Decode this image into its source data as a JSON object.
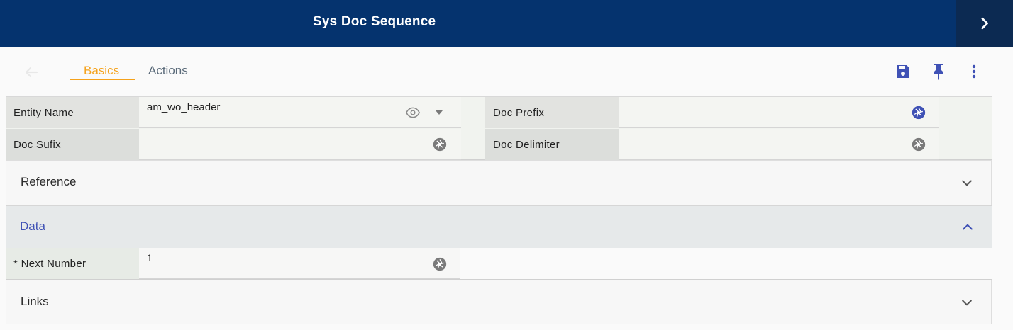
{
  "header": {
    "title": "Sys Doc Sequence",
    "next_icon": "chevron-right-icon"
  },
  "toolbar": {
    "back_icon": "arrow-left-icon",
    "tabs": [
      {
        "label": "Basics",
        "active": true
      },
      {
        "label": "Actions",
        "active": false
      }
    ],
    "save_icon": "save-icon",
    "pin_icon": "pin-icon",
    "more_icon": "more-vert-icon"
  },
  "form": {
    "entity_name": {
      "label": "Entity Name",
      "value": "am_wo_header"
    },
    "doc_prefix": {
      "label": "Doc Prefix",
      "value": ""
    },
    "doc_sufix": {
      "label": "Doc Sufix",
      "value": ""
    },
    "doc_delimiter": {
      "label": "Doc Delimiter",
      "value": ""
    }
  },
  "sections": {
    "reference": {
      "title": "Reference",
      "expanded": false
    },
    "data": {
      "title": "Data",
      "expanded": true
    },
    "links": {
      "title": "Links",
      "expanded": false
    }
  },
  "data_section": {
    "next_number": {
      "label": "* Next Number",
      "value": "1"
    }
  },
  "colors": {
    "header_bg": "#05336e",
    "accent_tab": "#f5a21b",
    "icon_blue": "#3f51b5"
  }
}
